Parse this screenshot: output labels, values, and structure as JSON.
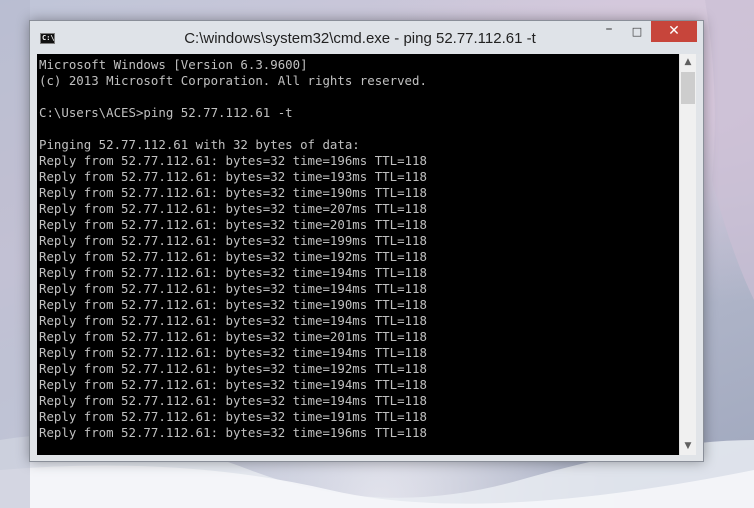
{
  "window": {
    "title": "C:\\windows\\system32\\cmd.exe - ping  52.77.112.61 -t",
    "icon": "cmd-prompt-icon",
    "icon_glyph": "C:\\",
    "controls": {
      "minimize": "–",
      "maximize": "□",
      "close": "✕"
    }
  },
  "console": {
    "lines": [
      "Microsoft Windows [Version 6.3.9600]",
      "(c) 2013 Microsoft Corporation. All rights reserved.",
      "",
      "C:\\Users\\ACES>ping 52.77.112.61 -t",
      "",
      "Pinging 52.77.112.61 with 32 bytes of data:",
      "Reply from 52.77.112.61: bytes=32 time=196ms TTL=118",
      "Reply from 52.77.112.61: bytes=32 time=193ms TTL=118",
      "Reply from 52.77.112.61: bytes=32 time=190ms TTL=118",
      "Reply from 52.77.112.61: bytes=32 time=207ms TTL=118",
      "Reply from 52.77.112.61: bytes=32 time=201ms TTL=118",
      "Reply from 52.77.112.61: bytes=32 time=199ms TTL=118",
      "Reply from 52.77.112.61: bytes=32 time=192ms TTL=118",
      "Reply from 52.77.112.61: bytes=32 time=194ms TTL=118",
      "Reply from 52.77.112.61: bytes=32 time=194ms TTL=118",
      "Reply from 52.77.112.61: bytes=32 time=190ms TTL=118",
      "Reply from 52.77.112.61: bytes=32 time=194ms TTL=118",
      "Reply from 52.77.112.61: bytes=32 time=201ms TTL=118",
      "Reply from 52.77.112.61: bytes=32 time=194ms TTL=118",
      "Reply from 52.77.112.61: bytes=32 time=192ms TTL=118",
      "Reply from 52.77.112.61: bytes=32 time=194ms TTL=118",
      "Reply from 52.77.112.61: bytes=32 time=194ms TTL=118",
      "Reply from 52.77.112.61: bytes=32 time=191ms TTL=118",
      "Reply from 52.77.112.61: bytes=32 time=196ms TTL=118"
    ]
  },
  "scrollbar": {
    "up_arrow": "▲",
    "down_arrow": "▼",
    "position": 0.0
  },
  "colors": {
    "console_background": "#000000",
    "console_text": "#c0c0c0",
    "close_button": "#c7453b",
    "titlebar": "#dfe3e8"
  }
}
